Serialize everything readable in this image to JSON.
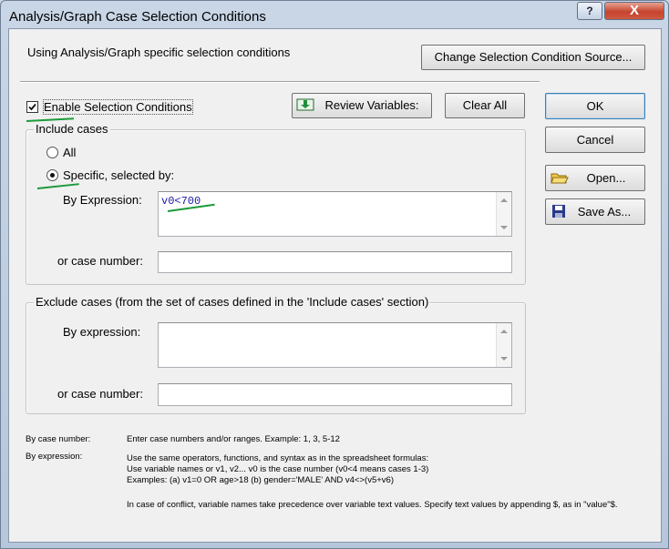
{
  "window": {
    "title": "Analysis/Graph Case Selection Conditions",
    "help_glyph": "?",
    "close_glyph": "X"
  },
  "header": {
    "source_text": "Using Analysis/Graph specific selection conditions",
    "change_source_button": "Change Selection Condition Source..."
  },
  "toolbar": {
    "enable_label": "Enable Selection Conditions",
    "enable_checked": true,
    "review_variables_button": "Review Variables:",
    "clear_all_button": "Clear All"
  },
  "side_buttons": {
    "ok": "OK",
    "cancel": "Cancel",
    "open": "Open...",
    "save_as": "Save As..."
  },
  "include": {
    "title": "Include cases",
    "all_label": "All",
    "specific_label": "Specific, selected by:",
    "selected": "specific",
    "expression_label": "By Expression:",
    "expression_value": "v0<700",
    "case_number_label": "or case number:",
    "case_number_value": ""
  },
  "exclude": {
    "title": "Exclude cases (from the set of cases defined in the 'Include cases' section)",
    "expression_label": "By expression:",
    "expression_value": "",
    "case_number_label": "or case number:",
    "case_number_value": ""
  },
  "help": {
    "case_number_title": "By case number:",
    "case_number_text": "Enter case numbers and/or ranges.  Example:  1, 3, 5-12",
    "expression_title": "By expression:",
    "expression_line1": "Use the same operators, functions, and syntax as in the spreadsheet formulas:",
    "expression_line2": "Use variable names or v1, v2...   v0 is the case number  (v0<4 means cases 1-3)",
    "expression_line3": "Examples:   (a) v1=0 OR age>18   (b) gender='MALE' AND v4<>(v5+v6)",
    "conflict_text": "In case of conflict, variable names take precedence over variable text values. Specify text values by appending $, as in \"value\"$."
  },
  "colors": {
    "annotation_green": "#1d9a3a",
    "expression_text": "#1a1aa6",
    "close_red": "#c5452f"
  }
}
